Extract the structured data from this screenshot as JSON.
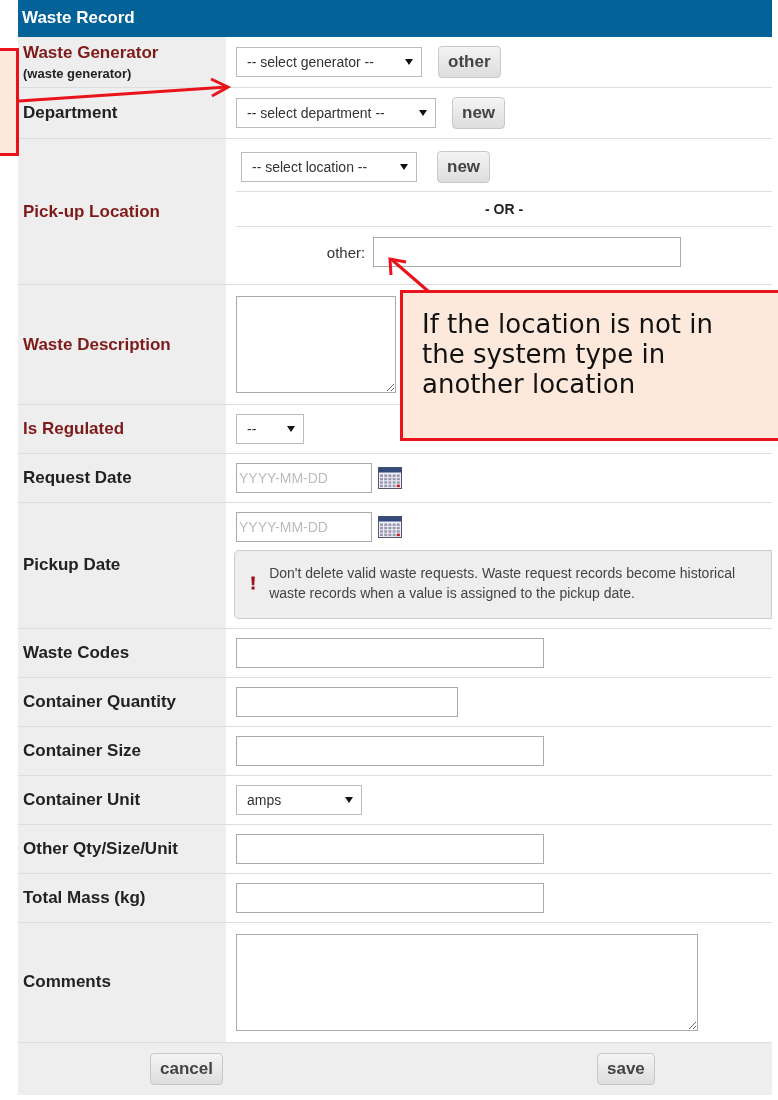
{
  "title": "Waste Record",
  "rows": [
    {
      "kind": "select-button",
      "label": "Waste Generator",
      "sublabel": "(waste generator)",
      "required": true,
      "select": "-- select generator --",
      "button": "other"
    },
    {
      "kind": "select-button",
      "label": "Department",
      "required": false,
      "select": "-- select department --",
      "button": "new"
    },
    {
      "kind": "location",
      "label": "Pick-up Location",
      "required": true,
      "select": "-- select location --",
      "button": "new",
      "separator": "- OR -",
      "other_label": "other:"
    },
    {
      "kind": "textarea",
      "label": "Waste Description",
      "required": true
    },
    {
      "kind": "select",
      "label": "Is Regulated",
      "required": true,
      "select": "--"
    },
    {
      "kind": "date",
      "label": "Request Date",
      "required": false,
      "placeholder": "YYYY-MM-DD"
    },
    {
      "kind": "date-note",
      "label": "Pickup Date",
      "required": false,
      "placeholder": "YYYY-MM-DD",
      "note": "Don't delete valid waste requests. Waste request records become historical waste records when a value is assigned to the pickup date."
    },
    {
      "kind": "input",
      "label": "Waste Codes",
      "required": false
    },
    {
      "kind": "short-input",
      "label": "Container Quantity",
      "required": false
    },
    {
      "kind": "input",
      "label": "Container Size",
      "required": false
    },
    {
      "kind": "select",
      "label": "Container Unit",
      "required": false,
      "select": "amps"
    },
    {
      "kind": "input",
      "label": "Other Qty/Size/Unit",
      "required": false
    },
    {
      "kind": "input",
      "label": "Total Mass (kg)",
      "required": false
    },
    {
      "kind": "wide-textarea",
      "label": "Comments",
      "required": false
    }
  ],
  "buttons": [
    "cancel",
    "save"
  ],
  "callouts": [
    {
      "kind": "edge"
    },
    {
      "kind": "text",
      "text": "If the location is not in the system type in another location"
    }
  ]
}
